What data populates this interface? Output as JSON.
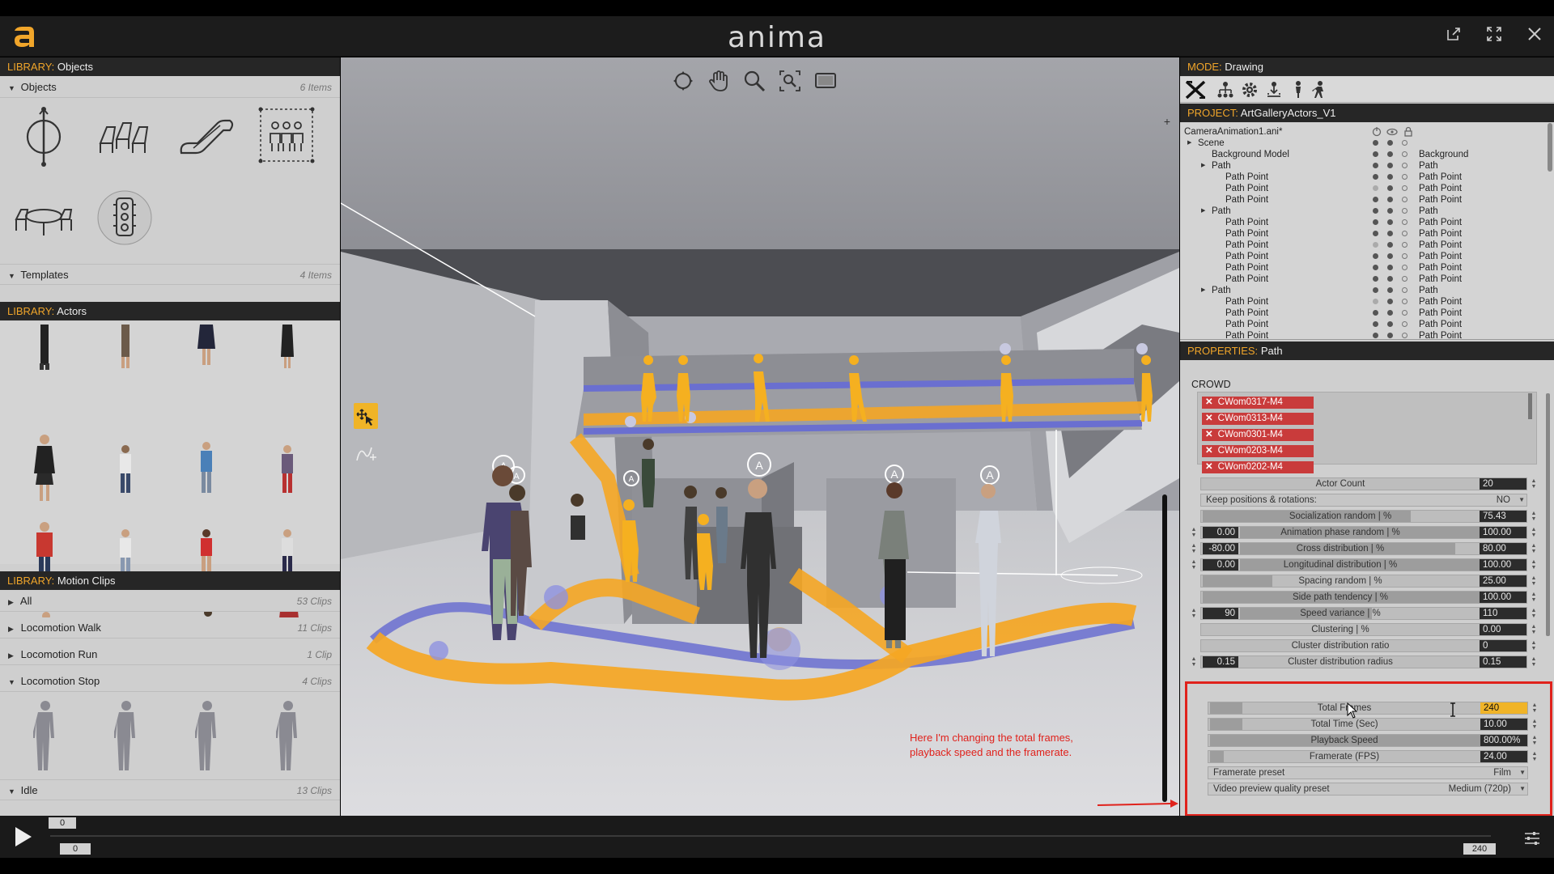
{
  "app": {
    "title": "anima"
  },
  "libraries": {
    "objects": {
      "header_key": "LIBRARY:",
      "header_value": "Objects",
      "section": {
        "label": "Objects",
        "count": "6 Items"
      },
      "templates": {
        "label": "Templates",
        "count": "4 Items"
      },
      "icons": [
        "revolving-door-icon",
        "cinema-seats-icon",
        "escalator-icon",
        "crowd-area-icon",
        "table-chairs-icon",
        "traffic-light-icon"
      ]
    },
    "actors": {
      "header_key": "LIBRARY:",
      "header_value": "Actors"
    },
    "motion_clips": {
      "header_key": "LIBRARY:",
      "header_value": "Motion Clips",
      "sections": [
        {
          "label": "All",
          "count": "53 Clips"
        },
        {
          "label": "Locomotion Walk",
          "count": "11 Clips"
        },
        {
          "label": "Locomotion Run",
          "count": "1 Clip"
        },
        {
          "label": "Locomotion Stop",
          "count": "4 Clips"
        },
        {
          "label": "Idle",
          "count": "13 Clips"
        }
      ]
    }
  },
  "mode": {
    "header_key": "MODE:",
    "header_value": "Drawing"
  },
  "project": {
    "header_key": "PROJECT:",
    "header_value": "ArtGalleryActors_V1",
    "file": "CameraAnimation1.ani*",
    "tree": [
      {
        "name": "Scene",
        "type": "",
        "indent": 1
      },
      {
        "name": "Background Model",
        "type": "Background",
        "indent": 2
      },
      {
        "name": "Path",
        "type": "Path",
        "indent": 2
      },
      {
        "name": "Path Point",
        "type": "Path Point",
        "indent": 3
      },
      {
        "name": "Path Point",
        "type": "Path Point",
        "indent": 3
      },
      {
        "name": "Path Point",
        "type": "Path Point",
        "indent": 3
      },
      {
        "name": "Path",
        "type": "Path",
        "indent": 2
      },
      {
        "name": "Path Point",
        "type": "Path Point",
        "indent": 3
      },
      {
        "name": "Path Point",
        "type": "Path Point",
        "indent": 3
      },
      {
        "name": "Path Point",
        "type": "Path Point",
        "indent": 3
      },
      {
        "name": "Path Point",
        "type": "Path Point",
        "indent": 3
      },
      {
        "name": "Path Point",
        "type": "Path Point",
        "indent": 3
      },
      {
        "name": "Path Point",
        "type": "Path Point",
        "indent": 3
      },
      {
        "name": "Path",
        "type": "Path",
        "indent": 2
      },
      {
        "name": "Path Point",
        "type": "Path Point",
        "indent": 3
      },
      {
        "name": "Path Point",
        "type": "Path Point",
        "indent": 3
      },
      {
        "name": "Path Point",
        "type": "Path Point",
        "indent": 3
      },
      {
        "name": "Path Point",
        "type": "Path Point",
        "indent": 3
      }
    ]
  },
  "properties": {
    "header_key": "PROPERTIES:",
    "header_value": "Path",
    "crowd_label": "CROWD",
    "crowd": [
      "CWom0317-M4",
      "CWom0313-M4",
      "CWom0301-M4",
      "CWom0203-M4",
      "CWom0202-M4"
    ],
    "rows": [
      {
        "label": "Actor Count",
        "value": "20",
        "fill": 0.0,
        "left": ""
      },
      {
        "label": "Keep positions & rotations:",
        "value": "NO",
        "type": "dropdown"
      },
      {
        "label": "Socialization random | %",
        "value": "75.43",
        "fill": 0.75,
        "left": ""
      },
      {
        "label": "Animation phase random | %",
        "value": "100.00",
        "fill": 1.0,
        "left": "0.00"
      },
      {
        "label": "Cross distribution | %",
        "value": "80.00",
        "fill": 0.9,
        "left": "-80.00"
      },
      {
        "label": "Longitudinal distribution | %",
        "value": "100.00",
        "fill": 1.0,
        "left": "0.00"
      },
      {
        "label": "Spacing random | %",
        "value": "25.00",
        "fill": 0.25,
        "left": ""
      },
      {
        "label": "Side path tendency | %",
        "value": "100.00",
        "fill": 1.0,
        "left": ""
      },
      {
        "label": "Speed variance | %",
        "value": "110",
        "fill": 0.55,
        "left": "90"
      },
      {
        "label": "Clustering | %",
        "value": "0.00",
        "fill": 0.0,
        "left": ""
      },
      {
        "label": "Cluster distribution ratio",
        "value": "0",
        "fill": 0.0,
        "left": ""
      },
      {
        "label": "Cluster distribution radius",
        "value": "0.15",
        "fill": 0.0,
        "left": "0.15"
      }
    ],
    "timing": [
      {
        "label": "Total Frames",
        "value": "240",
        "fill": 0.12,
        "editing": true
      },
      {
        "label": "Total Time (Sec)",
        "value": "10.00",
        "fill": 0.12
      },
      {
        "label": "Playback Speed",
        "value": "800.00%",
        "fill": 1.0
      },
      {
        "label": "Framerate (FPS)",
        "value": "24.00",
        "fill": 0.05
      },
      {
        "label": "Framerate preset",
        "value": "Film",
        "type": "dropdown"
      },
      {
        "label": "Video preview quality preset",
        "value": "Medium (720p)",
        "type": "dropdown"
      }
    ]
  },
  "annotation": {
    "line1": "Here I'm changing the total frames,",
    "line2": "playback speed and the framerate.",
    "color": "#e0221c"
  },
  "timeline": {
    "start": "0",
    "current": "0",
    "end": "240"
  },
  "colors": {
    "accent": "#f0a52a",
    "crowd": "#c93b3b",
    "highlight": "#e0221c",
    "path": "#f5a623"
  }
}
